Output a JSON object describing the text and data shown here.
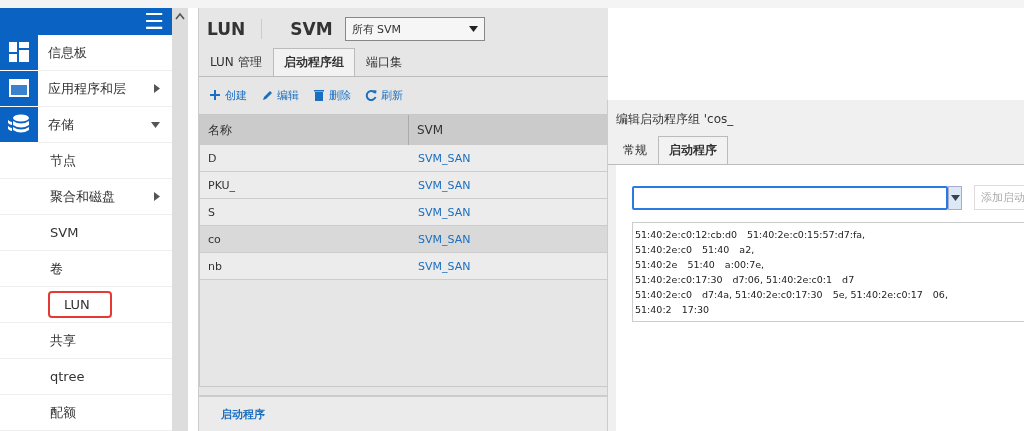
{
  "sidebar": {
    "menu_icon": "☰",
    "items": [
      {
        "label": "信息板",
        "highlighted": false
      },
      {
        "label": "应用程序和层",
        "highlighted": false,
        "expanded": false
      },
      {
        "label": "存储",
        "highlighted": false,
        "expanded": true,
        "children": [
          {
            "label": "节点",
            "highlighted": false
          },
          {
            "label": "聚合和磁盘",
            "highlighted": false,
            "expanded": false
          },
          {
            "label": "SVM",
            "highlighted": false
          },
          {
            "label": "卷",
            "highlighted": false
          },
          {
            "label": "LUN",
            "highlighted": true
          },
          {
            "label": "共享",
            "highlighted": false
          },
          {
            "label": "qtree",
            "highlighted": false
          },
          {
            "label": "配额",
            "highlighted": false
          }
        ]
      }
    ]
  },
  "page": {
    "title": "LUN",
    "svm_label": "SVM",
    "svm_select": "所有 SVM",
    "tabs": [
      {
        "label": "LUN 管理",
        "selected": false
      },
      {
        "label": "启动程序组",
        "selected": true
      },
      {
        "label": "端口集",
        "selected": false
      }
    ],
    "toolbar": [
      {
        "label": "创建",
        "kind": "plus"
      },
      {
        "label": "编辑",
        "kind": "pencil"
      },
      {
        "label": "删除",
        "kind": "trash"
      },
      {
        "label": "刷新",
        "kind": "refresh"
      }
    ],
    "table": {
      "columns": [
        "名称",
        "SVM"
      ],
      "rows": [
        {
          "name": "D",
          "svm": "SVM_SAN",
          "selected": false
        },
        {
          "name": "PKU_",
          "svm": "SVM_SAN",
          "selected": false
        },
        {
          "name": "S",
          "svm": "SVM_SAN",
          "selected": false
        },
        {
          "name": "co",
          "svm": "SVM_SAN",
          "selected": true
        },
        {
          "name": "nb",
          "svm": "SVM_SAN",
          "selected": false
        }
      ]
    },
    "bottom_panel": {
      "title": "启动程序"
    }
  },
  "dialog": {
    "title": "编辑启动程序组 'cos_",
    "tabs": [
      {
        "label": "常规",
        "selected": false
      },
      {
        "label": "启动程序",
        "selected": true
      }
    ],
    "add_button": "添加启动",
    "initiators": [
      [
        "51:40:2e:c0:12:cb:d0",
        "51:40:2e:c0:15:57:d7:fa,"
      ],
      [
        "51:40:2e:c0",
        "51:40",
        "a2,"
      ],
      [
        "51:40:2e",
        "51:40",
        "a:00:7e,"
      ],
      [
        "51:40:2e:c0:17:30",
        "d7:06, 51:40:2e:c0:1",
        "d7"
      ],
      [
        "51:40:2e:c0",
        "d7:4a, 51:40:2e:c0:17:30",
        "5e, 51:40:2e:c0:17",
        "06,"
      ],
      [
        "51:40:2",
        "17:30"
      ]
    ]
  }
}
